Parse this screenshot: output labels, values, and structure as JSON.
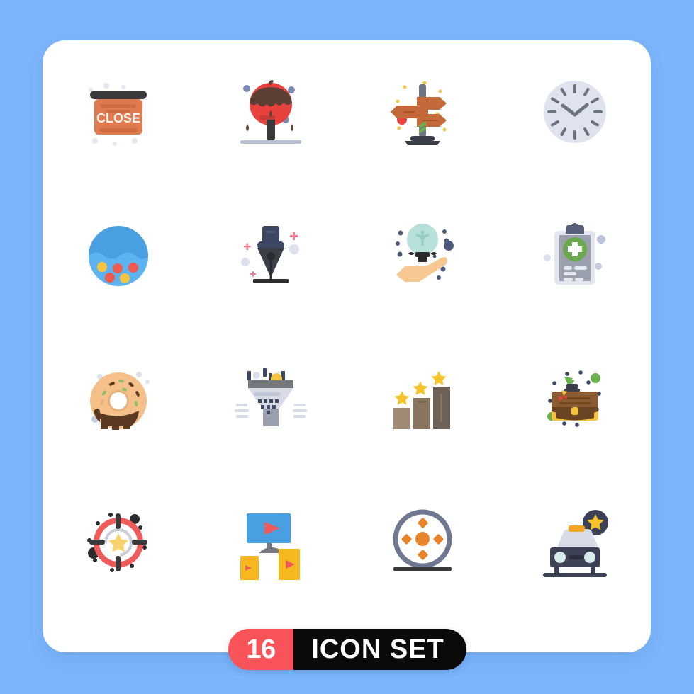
{
  "page": {
    "background_color": "#7cb5fb",
    "card_color": "#ffffff"
  },
  "badge": {
    "count": "16",
    "label": "ICON SET",
    "count_bg": "#f9535a",
    "label_bg": "#0a0a0a",
    "text_color": "#ffffff"
  },
  "grid": {
    "columns": 4,
    "rows": 4,
    "total": 16
  },
  "icons": [
    {
      "index": 1,
      "name": "close-sign-icon",
      "title": "Close Sign",
      "sign_text": "CLOSE",
      "colors": [
        "#e07a4f",
        "#3a3a3c",
        "#f7f3ee"
      ]
    },
    {
      "index": 2,
      "name": "candy-apple-icon",
      "title": "Candy Apple",
      "colors": [
        "#e8423f",
        "#5c4033",
        "#3a3a3c"
      ]
    },
    {
      "index": 3,
      "name": "signpost-icon",
      "title": "Signpost",
      "colors": [
        "#c4693a",
        "#6e7684",
        "#e8423f"
      ]
    },
    {
      "index": 4,
      "name": "clock-icon",
      "title": "Clock",
      "colors": [
        "#dfe3ed",
        "#6b7280"
      ]
    },
    {
      "index": 5,
      "name": "ball-pool-icon",
      "title": "Ball Pool",
      "colors": [
        "#4a9fe0",
        "#5cb3f0",
        "#f5c542",
        "#ef5b4e"
      ]
    },
    {
      "index": 6,
      "name": "fountain-pen-nib-icon",
      "title": "Fountain Pen Nib",
      "colors": [
        "#3a3f4a",
        "#3c4763",
        "#2b2b2e"
      ]
    },
    {
      "index": 7,
      "name": "idea-in-hand-icon",
      "title": "Idea In Hand",
      "colors": [
        "#f7c891",
        "#b8e0da",
        "#2b2b2e"
      ]
    },
    {
      "index": 8,
      "name": "medical-clipboard-icon",
      "title": "Medical Clipboard",
      "colors": [
        "#c9ced8",
        "#9aa0ad",
        "#6aa84f",
        "#566078"
      ]
    },
    {
      "index": 9,
      "name": "donut-icon",
      "title": "Donut",
      "colors": [
        "#f5c089",
        "#5c3a22",
        "#e8b07a",
        "#8fbf6a"
      ]
    },
    {
      "index": 10,
      "name": "sales-funnel-icon",
      "title": "Sales Funnel",
      "colors": [
        "#d8dbe6",
        "#76787f",
        "#f5c542",
        "#3c4763"
      ]
    },
    {
      "index": 11,
      "name": "ranking-bars-icon",
      "title": "Ranking Bars",
      "colors": [
        "#a08a75",
        "#8a755f",
        "#6e6256",
        "#f5c22a"
      ]
    },
    {
      "index": 12,
      "name": "business-briefcase-icon",
      "title": "Business Briefcase",
      "colors": [
        "#8a5a32",
        "#6b4424",
        "#f5c542",
        "#6ab04c"
      ]
    },
    {
      "index": 13,
      "name": "target-star-icon",
      "title": "Target Star",
      "colors": [
        "#ef5b5b",
        "#3a3a3c",
        "#f7d36e",
        "#c9ced8"
      ]
    },
    {
      "index": 14,
      "name": "video-sharing-icon",
      "title": "Video Sharing",
      "colors": [
        "#4a9fe0",
        "#f5b81f",
        "#ef5b5b",
        "#76787f"
      ]
    },
    {
      "index": 15,
      "name": "film-reel-icon",
      "title": "Film Reel",
      "colors": [
        "#6e7891",
        "#e8842a",
        "#3a3a3c"
      ]
    },
    {
      "index": 16,
      "name": "taxi-rating-icon",
      "title": "Taxi Rating",
      "colors": [
        "#3c4156",
        "#d8dce8",
        "#f5a623",
        "#f5c22a"
      ]
    }
  ]
}
